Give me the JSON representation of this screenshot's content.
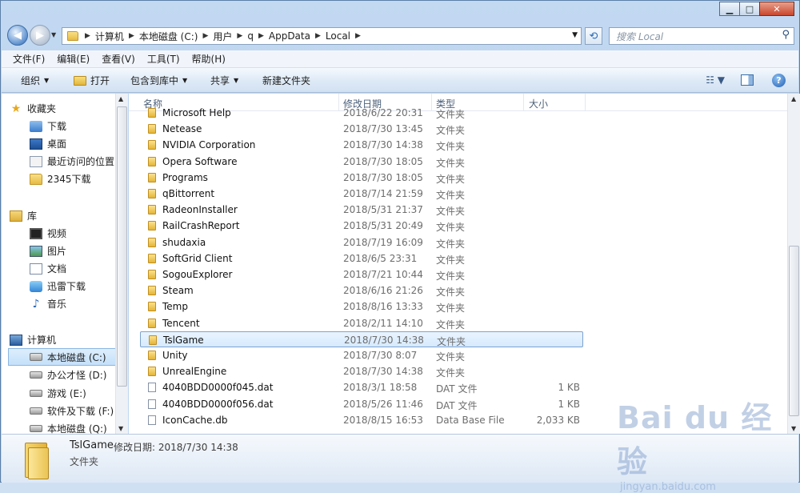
{
  "window": {
    "caption_buttons": {
      "minimize": "▁",
      "maximize": "□",
      "close": "✕"
    }
  },
  "address": {
    "crumbs": [
      "计算机",
      "本地磁盘 (C:)",
      "用户",
      "q",
      "AppData",
      "Local"
    ],
    "search_placeholder": "搜索 Local"
  },
  "menubar": {
    "items": [
      "文件(F)",
      "编辑(E)",
      "查看(V)",
      "工具(T)",
      "帮助(H)"
    ]
  },
  "toolbar": {
    "organize": "组织",
    "open": "打开",
    "include_in_library": "包含到库中",
    "share": "共享",
    "new_folder": "新建文件夹"
  },
  "sidebar": {
    "favorites": {
      "label": "收藏夹",
      "items": [
        "下载",
        "桌面",
        "最近访问的位置",
        "2345下载"
      ]
    },
    "libraries": {
      "label": "库",
      "items": [
        "视频",
        "图片",
        "文档",
        "迅雷下载",
        "音乐"
      ]
    },
    "computer": {
      "label": "计算机",
      "items": [
        "本地磁盘 (C:)",
        "办公才怪 (D:)",
        "游戏 (E:)",
        "软件及下载 (F:)",
        "本地磁盘 (Q:)"
      ]
    }
  },
  "columns": {
    "name": "名称",
    "date": "修改日期",
    "type": "类型",
    "size": "大小"
  },
  "files": [
    {
      "name": "Microsoft Help",
      "date": "2018/6/22 20:31",
      "type": "文件夹",
      "size": "",
      "kind": "folder"
    },
    {
      "name": "Netease",
      "date": "2018/7/30 13:45",
      "type": "文件夹",
      "size": "",
      "kind": "folder"
    },
    {
      "name": "NVIDIA Corporation",
      "date": "2018/7/30 14:38",
      "type": "文件夹",
      "size": "",
      "kind": "folder"
    },
    {
      "name": "Opera Software",
      "date": "2018/7/30 18:05",
      "type": "文件夹",
      "size": "",
      "kind": "folder"
    },
    {
      "name": "Programs",
      "date": "2018/7/30 18:05",
      "type": "文件夹",
      "size": "",
      "kind": "folder"
    },
    {
      "name": "qBittorrent",
      "date": "2018/7/14 21:59",
      "type": "文件夹",
      "size": "",
      "kind": "folder"
    },
    {
      "name": "RadeonInstaller",
      "date": "2018/5/31 21:37",
      "type": "文件夹",
      "size": "",
      "kind": "folder"
    },
    {
      "name": "RailCrashReport",
      "date": "2018/5/31 20:49",
      "type": "文件夹",
      "size": "",
      "kind": "folder"
    },
    {
      "name": "shudaxia",
      "date": "2018/7/19 16:09",
      "type": "文件夹",
      "size": "",
      "kind": "folder"
    },
    {
      "name": "SoftGrid Client",
      "date": "2018/6/5 23:31",
      "type": "文件夹",
      "size": "",
      "kind": "folder"
    },
    {
      "name": "SogouExplorer",
      "date": "2018/7/21 10:44",
      "type": "文件夹",
      "size": "",
      "kind": "folder"
    },
    {
      "name": "Steam",
      "date": "2018/6/16 21:26",
      "type": "文件夹",
      "size": "",
      "kind": "folder"
    },
    {
      "name": "Temp",
      "date": "2018/8/16 13:33",
      "type": "文件夹",
      "size": "",
      "kind": "folder"
    },
    {
      "name": "Tencent",
      "date": "2018/2/11 14:10",
      "type": "文件夹",
      "size": "",
      "kind": "folder"
    },
    {
      "name": "TslGame",
      "date": "2018/7/30 14:38",
      "type": "文件夹",
      "size": "",
      "kind": "folder",
      "selected": true
    },
    {
      "name": "Unity",
      "date": "2018/7/30 8:07",
      "type": "文件夹",
      "size": "",
      "kind": "folder"
    },
    {
      "name": "UnrealEngine",
      "date": "2018/7/30 14:38",
      "type": "文件夹",
      "size": "",
      "kind": "folder"
    },
    {
      "name": "4040BDD0000f045.dat",
      "date": "2018/3/1 18:58",
      "type": "DAT 文件",
      "size": "1 KB",
      "kind": "file"
    },
    {
      "name": "4040BDD0000f056.dat",
      "date": "2018/5/26 11:46",
      "type": "DAT 文件",
      "size": "1 KB",
      "kind": "file"
    },
    {
      "name": "IconCache.db",
      "date": "2018/8/15 16:53",
      "type": "Data Base File",
      "size": "2,033 KB",
      "kind": "db"
    }
  ],
  "details": {
    "name": "TslGame",
    "meta_label": "修改日期:",
    "meta_value": "2018/7/30 14:38",
    "type": "文件夹"
  },
  "watermark": {
    "brand": "Bai du 经验",
    "url": "jingyan.baidu.com"
  }
}
